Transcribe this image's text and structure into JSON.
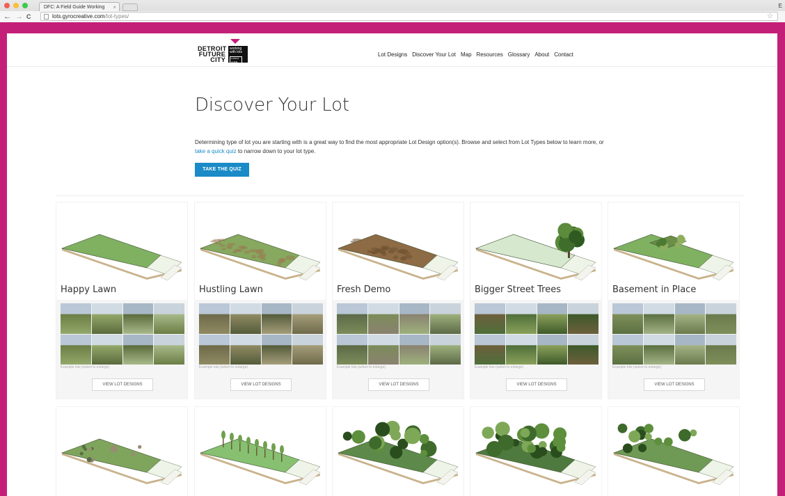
{
  "browser": {
    "tab_title": "DFC: A Field Guide Working",
    "tab_close": "×",
    "user_initial": "E",
    "url_host": "lots.gyrocreative.com",
    "url_path": "/lot-types/",
    "back": "←",
    "forward": "→",
    "reload": "C",
    "star": "☆"
  },
  "site": {
    "logo_line1": "DETROIT",
    "logo_line2": "FUTURE",
    "logo_line3": "CITY",
    "logo_box_line1": "working",
    "logo_box_line2": "with lots",
    "logo_box_tag": "A FIELD GUIDE",
    "accent": "#c41f78",
    "link_color": "#1a8bc6",
    "nav": [
      "Lot Designs",
      "Discover Your Lot",
      "Map",
      "Resources",
      "Glossary",
      "About",
      "Contact"
    ]
  },
  "main": {
    "title": "Discover Your Lot",
    "intro_part1": "Determining type of lot you are starting with is a great way to find the most appropriate Lot Design option(s). Browse and select from Lot Types below to learn more, or ",
    "intro_link": "take a quick quiz",
    "intro_part2": " to narrow down to your lot type.",
    "quiz_button": "TAKE THE QUIZ"
  },
  "cards": [
    {
      "title": "Happy Lawn",
      "caption": "Example lots (select to enlarge)",
      "button": "VIEW LOT DESIGNS",
      "lot_color": "#7fb161",
      "feature": "none"
    },
    {
      "title": "Hustling Lawn",
      "caption": "Example lots (select to enlarge)",
      "button": "VIEW LOT DESIGNS",
      "lot_color": "#86a95f",
      "feature": "patchy"
    },
    {
      "title": "Fresh Demo",
      "caption": "Example lots (select to enlarge)",
      "button": "VIEW LOT DESIGNS",
      "lot_color": "#8d6b45",
      "feature": "dirt"
    },
    {
      "title": "Bigger Street Trees",
      "caption": "Example lots (select to enlarge)",
      "button": "VIEW LOT DESIGNS",
      "lot_color": "#d6e8cd",
      "feature": "tree"
    },
    {
      "title": "Basement in Place",
      "caption": "Example lots (select to enlarge)",
      "button": "VIEW LOT DESIGNS",
      "lot_color": "#7fb161",
      "feature": "basement"
    }
  ],
  "cards_row2": [
    {
      "lot_color": "#7fa55d",
      "feature": "shrubs"
    },
    {
      "lot_color": "#87c071",
      "feature": "saplings"
    },
    {
      "lot_color": "#5d8a4a",
      "feature": "dense"
    },
    {
      "lot_color": "#4f7a3f",
      "feature": "forest"
    },
    {
      "lot_color": "#6f9a55",
      "feature": "mixed"
    }
  ]
}
